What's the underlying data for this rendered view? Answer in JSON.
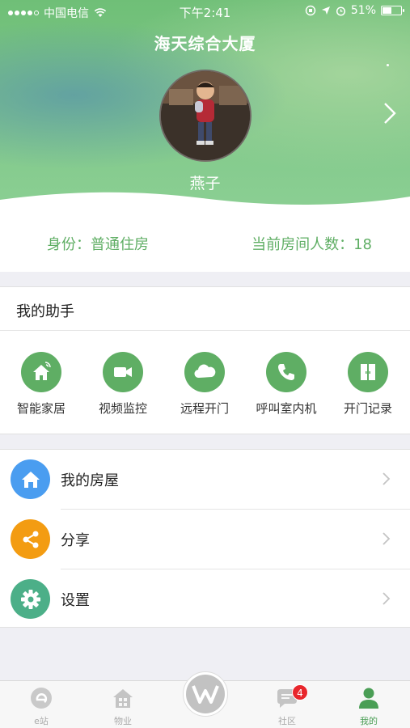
{
  "status_bar": {
    "carrier": "中国电信",
    "time": "下午2:41",
    "battery": "51%",
    "battery_level": 0.51
  },
  "header": {
    "building": "海天综合大厦",
    "username": "燕子"
  },
  "identity": {
    "role_label": "身份：",
    "role_value": "普通住房",
    "count_label": "当前房间人数：",
    "count_value": "18"
  },
  "assistant": {
    "title": "我的助手",
    "tools": [
      {
        "label": "智能家居",
        "icon": "smart-home-icon"
      },
      {
        "label": "视频监控",
        "icon": "video-camera-icon"
      },
      {
        "label": "远程开门",
        "icon": "cloud-icon"
      },
      {
        "label": "呼叫室内机",
        "icon": "phone-icon"
      },
      {
        "label": "开门记录",
        "icon": "door-record-icon"
      }
    ]
  },
  "menu": {
    "items": [
      {
        "label": "我的房屋",
        "icon": "house-icon",
        "color": "#4a9df0"
      },
      {
        "label": "分享",
        "icon": "share-icon",
        "color": "#f39c12"
      },
      {
        "label": "设置",
        "icon": "gear-icon",
        "color": "#4caf88"
      }
    ]
  },
  "tabbar": {
    "tabs": [
      {
        "label": "e站",
        "icon": "e-station-icon"
      },
      {
        "label": "物业",
        "icon": "property-icon"
      },
      {
        "label": "",
        "icon": "center-logo-icon"
      },
      {
        "label": "社区",
        "icon": "community-icon",
        "badge": "4"
      },
      {
        "label": "我的",
        "icon": "person-icon",
        "active": true
      }
    ]
  },
  "colors": {
    "accent": "#5fae64",
    "badge": "#e8262c"
  }
}
